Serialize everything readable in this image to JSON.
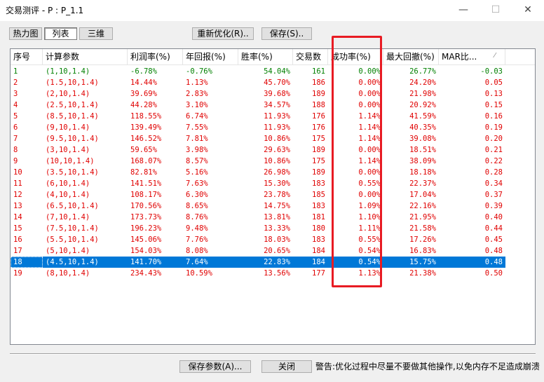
{
  "window": {
    "title": "交易测评 - P : P_1.1",
    "min_glyph": "—",
    "max_glyph": "☐",
    "close_glyph": "✕"
  },
  "view_tabs": {
    "heatmap": "热力图",
    "list": "列表",
    "three_d": "三维"
  },
  "toolbar": {
    "reoptimize": "重新优化(R)..",
    "save": "保存(S).."
  },
  "table": {
    "columns": [
      "序号",
      "计算参数",
      "利润率(%)",
      "年回报(%)",
      "胜率(%)",
      "交易数",
      "成功率(%)",
      "最大回撤(%)",
      "MAR比..."
    ],
    "sort_indicator": "⁄",
    "rows": [
      [
        "1",
        "(1,10,1.4)",
        "-6.78%",
        "-0.76%",
        "54.04%",
        "161",
        "0.00%",
        "26.77%",
        "-0.03"
      ],
      [
        "2",
        "(1.5,10,1.4)",
        "14.44%",
        "1.13%",
        "45.70%",
        "186",
        "0.00%",
        "24.20%",
        "0.05"
      ],
      [
        "3",
        "(2,10,1.4)",
        "39.69%",
        "2.83%",
        "39.68%",
        "189",
        "0.00%",
        "21.98%",
        "0.13"
      ],
      [
        "4",
        "(2.5,10,1.4)",
        "44.28%",
        "3.10%",
        "34.57%",
        "188",
        "0.00%",
        "20.92%",
        "0.15"
      ],
      [
        "5",
        "(8.5,10,1.4)",
        "118.55%",
        "6.74%",
        "11.93%",
        "176",
        "1.14%",
        "41.59%",
        "0.16"
      ],
      [
        "6",
        "(9,10,1.4)",
        "139.49%",
        "7.55%",
        "11.93%",
        "176",
        "1.14%",
        "40.35%",
        "0.19"
      ],
      [
        "7",
        "(9.5,10,1.4)",
        "146.52%",
        "7.81%",
        "10.86%",
        "175",
        "1.14%",
        "39.08%",
        "0.20"
      ],
      [
        "8",
        "(3,10,1.4)",
        "59.65%",
        "3.98%",
        "29.63%",
        "189",
        "0.00%",
        "18.51%",
        "0.21"
      ],
      [
        "9",
        "(10,10,1.4)",
        "168.07%",
        "8.57%",
        "10.86%",
        "175",
        "1.14%",
        "38.09%",
        "0.22"
      ],
      [
        "10",
        "(3.5,10,1.4)",
        "82.81%",
        "5.16%",
        "26.98%",
        "189",
        "0.00%",
        "18.18%",
        "0.28"
      ],
      [
        "11",
        "(6,10,1.4)",
        "141.51%",
        "7.63%",
        "15.30%",
        "183",
        "0.55%",
        "22.37%",
        "0.34"
      ],
      [
        "12",
        "(4,10,1.4)",
        "108.17%",
        "6.30%",
        "23.78%",
        "185",
        "0.00%",
        "17.04%",
        "0.37"
      ],
      [
        "13",
        "(6.5,10,1.4)",
        "170.56%",
        "8.65%",
        "14.75%",
        "183",
        "1.09%",
        "22.16%",
        "0.39"
      ],
      [
        "14",
        "(7,10,1.4)",
        "173.73%",
        "8.76%",
        "13.81%",
        "181",
        "1.10%",
        "21.95%",
        "0.40"
      ],
      [
        "15",
        "(7.5,10,1.4)",
        "196.23%",
        "9.48%",
        "13.33%",
        "180",
        "1.11%",
        "21.58%",
        "0.44"
      ],
      [
        "16",
        "(5.5,10,1.4)",
        "145.06%",
        "7.76%",
        "18.03%",
        "183",
        "0.55%",
        "17.26%",
        "0.45"
      ],
      [
        "17",
        "(5,10,1.4)",
        "154.03%",
        "8.08%",
        "20.65%",
        "184",
        "0.54%",
        "16.83%",
        "0.48"
      ],
      [
        "18",
        "(4.5,10,1.4)",
        "141.70%",
        "7.64%",
        "22.83%",
        "184",
        "0.54%",
        "15.75%",
        "0.48"
      ],
      [
        "19",
        "(8,10,1.4)",
        "234.43%",
        "10.59%",
        "13.56%",
        "177",
        "1.13%",
        "21.38%",
        "0.50"
      ]
    ],
    "row_colors": [
      "green",
      "red",
      "red",
      "red",
      "red",
      "red",
      "red",
      "red",
      "red",
      "red",
      "red",
      "red",
      "red",
      "red",
      "red",
      "red",
      "red",
      "sel",
      "red"
    ],
    "selected_row": 18
  },
  "footer": {
    "save_params": "保存参数(A)...",
    "close": "关闭",
    "warning": "警告:优化过程中尽量不要做其他操作,以免内存不足造成崩溃"
  },
  "colors": {
    "positive_text": "#008000",
    "negative_text": "#e00000",
    "selection": "#0078d7",
    "highlight_box": "#e81b23"
  }
}
